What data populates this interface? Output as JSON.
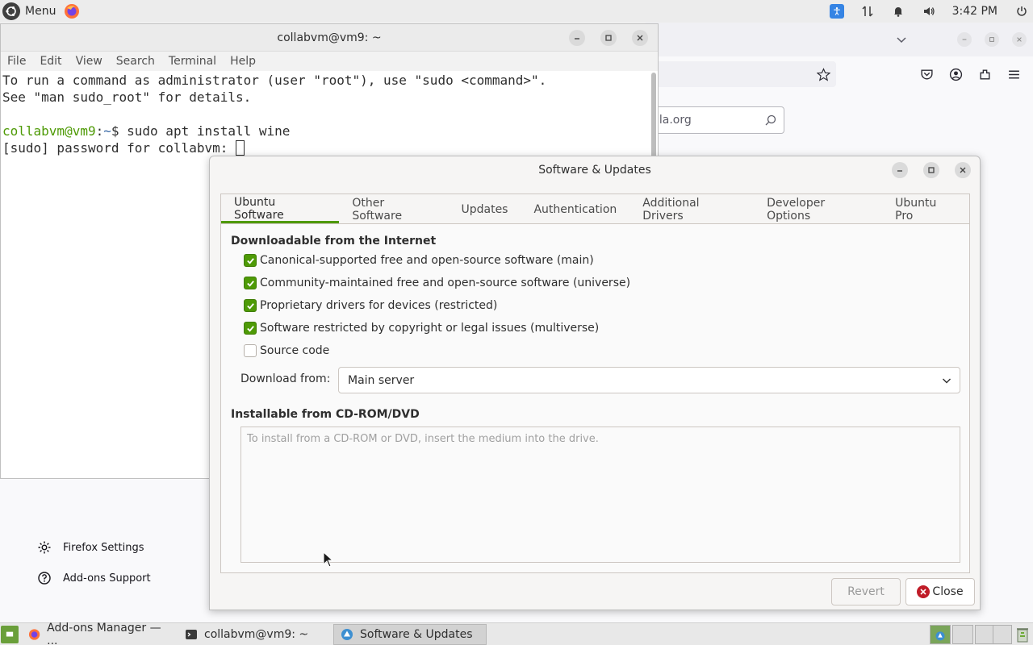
{
  "top_panel": {
    "menu_label": "Menu",
    "clock": "3:42 PM",
    "icons": [
      "ubuntu-logo-icon",
      "firefox-icon",
      "accessibility-icon",
      "network-icon",
      "notification-bell-icon",
      "volume-icon",
      "power-icon"
    ]
  },
  "firefox": {
    "search_placeholder": "lla.org",
    "bottom_links": [
      "Firefox Settings",
      "Add-ons Support"
    ]
  },
  "terminal": {
    "title": "collabvm@vm9: ~",
    "menu": [
      "File",
      "Edit",
      "View",
      "Search",
      "Terminal",
      "Help"
    ],
    "lines": [
      "To run a command as administrator (user \"root\"), use \"sudo <command>\".",
      "See \"man sudo_root\" for details."
    ],
    "prompt_user": "collabvm@vm9",
    "prompt_sep": ":",
    "prompt_path": "~",
    "prompt_symbol": "$ ",
    "command": "sudo apt install wine",
    "sudo_prompt": "[sudo] password for collabvm: "
  },
  "software_updates": {
    "title": "Software & Updates",
    "tabs": [
      "Ubuntu Software",
      "Other Software",
      "Updates",
      "Authentication",
      "Additional Drivers",
      "Developer Options",
      "Ubuntu Pro"
    ],
    "active_tab": "Ubuntu Software",
    "downloadable_heading": "Downloadable from the Internet",
    "sources": [
      {
        "label": "Canonical-supported free and open-source software (main)",
        "checked": true
      },
      {
        "label": "Community-maintained free and open-source software (universe)",
        "checked": true
      },
      {
        "label": "Proprietary drivers for devices (restricted)",
        "checked": true
      },
      {
        "label": "Software restricted by copyright or legal issues (multiverse)",
        "checked": true
      },
      {
        "label": "Source code",
        "checked": false
      }
    ],
    "download_from_label": "Download from:",
    "download_from_value": "Main server",
    "cdrom_heading": "Installable from CD-ROM/DVD",
    "cdrom_placeholder": "To install from a CD-ROM or DVD, insert the medium into the drive.",
    "revert_label": "Revert",
    "close_label": "Close"
  },
  "taskbar": {
    "tasks": [
      {
        "label": "Add-ons Manager — ...",
        "icon": "firefox-icon",
        "active": false
      },
      {
        "label": "collabvm@vm9: ~",
        "icon": "terminal-icon",
        "active": false
      },
      {
        "label": "Software & Updates",
        "icon": "software-updates-icon",
        "active": true
      }
    ]
  },
  "colors": {
    "accent_green": "#4e9a06",
    "close_red": "#c01c28",
    "prompt_blue": "#3465a4"
  }
}
